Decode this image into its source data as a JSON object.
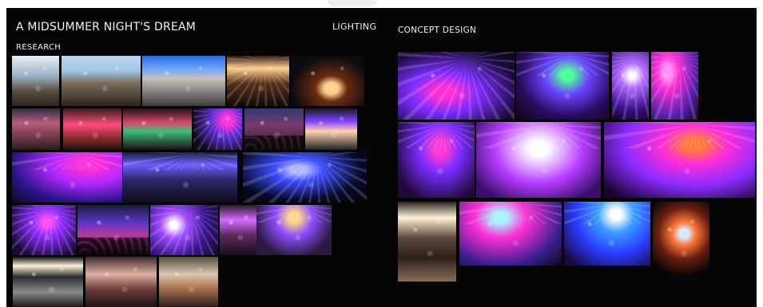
{
  "board": {
    "title": "A MIDSUMMER NIGHT'S DREAM",
    "research_label": "RESEARCH",
    "lighting_label": "LIGHTING",
    "concept_label": "CONCEPT  DESIGN"
  },
  "colors": {
    "board_background": "#050505",
    "page_background": "#ffffff",
    "text": "#f2f2f2",
    "accent_purple": "#7b2cff",
    "accent_magenta": "#ff2fd6",
    "accent_blue": "#2a55ff"
  }
}
